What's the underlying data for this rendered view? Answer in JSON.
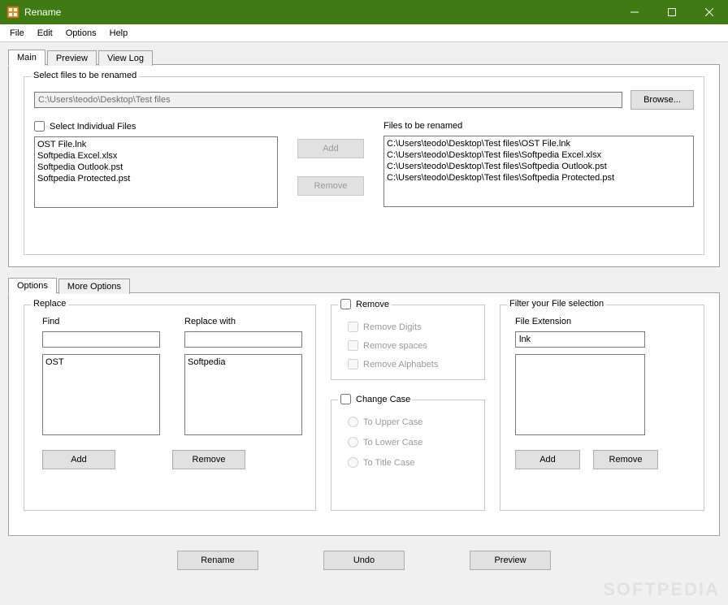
{
  "window": {
    "title": "Rename"
  },
  "menubar": [
    "File",
    "Edit",
    "Options",
    "Help"
  ],
  "main_tabs": {
    "labels": [
      "Main",
      "Preview",
      "View Log"
    ],
    "active": 0
  },
  "select_files": {
    "groupbox_title": "Select files to be renamed",
    "folder_path": "C:\\Users\\teodo\\Desktop\\Test files",
    "browse_label": "Browse...",
    "select_individual_label": "Select Individual Files",
    "select_individual_checked": false,
    "individual_list": [
      "OST File.lnk",
      "Softpedia Excel.xlsx",
      "Softpedia Outlook.pst",
      "Softpedia Protected.pst"
    ],
    "add_label": "Add",
    "remove_label": "Remove",
    "files_to_rename_label": "Files to be renamed",
    "files_to_rename": [
      "C:\\Users\\teodo\\Desktop\\Test files\\OST File.lnk",
      "C:\\Users\\teodo\\Desktop\\Test files\\Softpedia Excel.xlsx",
      "C:\\Users\\teodo\\Desktop\\Test files\\Softpedia Outlook.pst",
      "C:\\Users\\teodo\\Desktop\\Test files\\Softpedia Protected.pst"
    ]
  },
  "options_tabs": {
    "labels": [
      "Options",
      "More Options"
    ],
    "active": 0
  },
  "replace": {
    "groupbox_title": "Replace",
    "find_label": "Find",
    "replace_with_label": "Replace with",
    "find_value": "",
    "replace_value": "",
    "find_list": [
      "OST"
    ],
    "replace_list": [
      "Softpedia"
    ],
    "add_label": "Add",
    "remove_label": "Remove"
  },
  "remove_section": {
    "title": "Remove",
    "enabled": false,
    "remove_digits": "Remove Digits",
    "remove_spaces": "Remove spaces",
    "remove_alphabets": "Remove Alphabets"
  },
  "change_case": {
    "title": "Change Case",
    "enabled": false,
    "upper": "To Upper Case",
    "lower": "To Lower Case",
    "title_case": "To Title Case"
  },
  "filter": {
    "groupbox_title": "Filter your File selection",
    "extension_label": "File Extension",
    "extension_value": "lnk",
    "add_label": "Add",
    "remove_label": "Remove"
  },
  "actions": {
    "rename": "Rename",
    "undo": "Undo",
    "preview": "Preview"
  },
  "watermark": "SOFTPEDIA"
}
